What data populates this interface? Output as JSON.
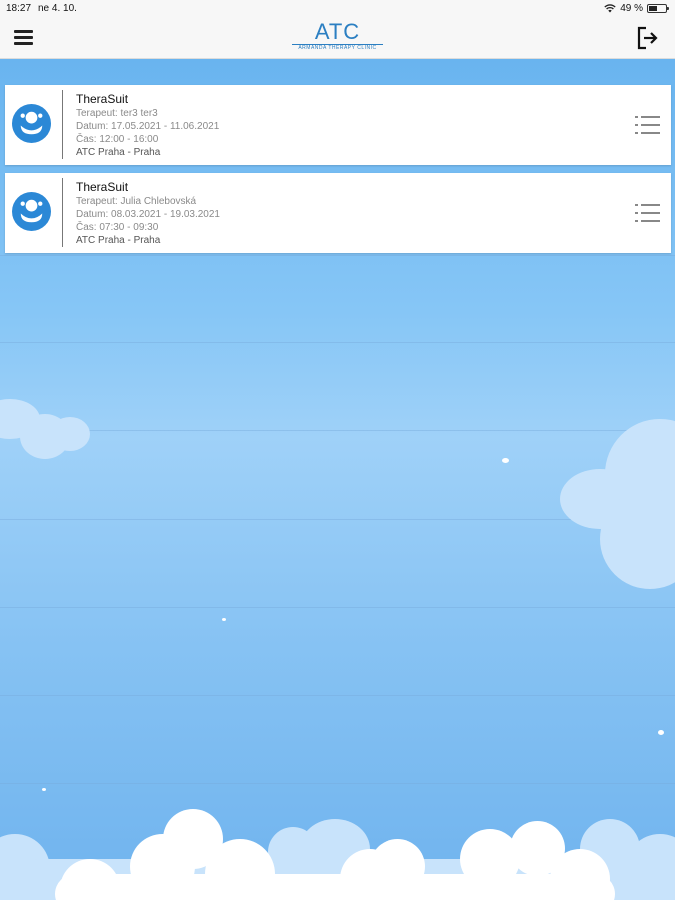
{
  "status": {
    "time": "18:27",
    "date": "ne 4. 10.",
    "battery": "49 %",
    "battery_level": 0.49
  },
  "header": {
    "logo_title": "ATC",
    "logo_subtitle": "ARMANDA THERAPY CLINIC"
  },
  "appointments": [
    {
      "title": "TheraSuit",
      "therapist": "Terapeut: ter3 ter3",
      "dates": "Datum: 17.05.2021 - 11.06.2021",
      "time": "Čas: 12:00 - 16:00",
      "location": "ATC Praha - Praha"
    },
    {
      "title": "TheraSuit",
      "therapist": "Terapeut: Julia  Chlebovská",
      "dates": "Datum: 08.03.2021 - 19.03.2021",
      "time": "Čas: 07:30 - 09:30",
      "location": "ATC Praha - Praha"
    }
  ],
  "colors": {
    "accent": "#2b88d6",
    "background_top": "#69b4ef",
    "background_mid": "#9fd1f8"
  },
  "icons": {
    "menu": "hamburger-icon",
    "logout": "logout-icon",
    "avatar": "therapy-child-icon",
    "details": "list-icon"
  }
}
